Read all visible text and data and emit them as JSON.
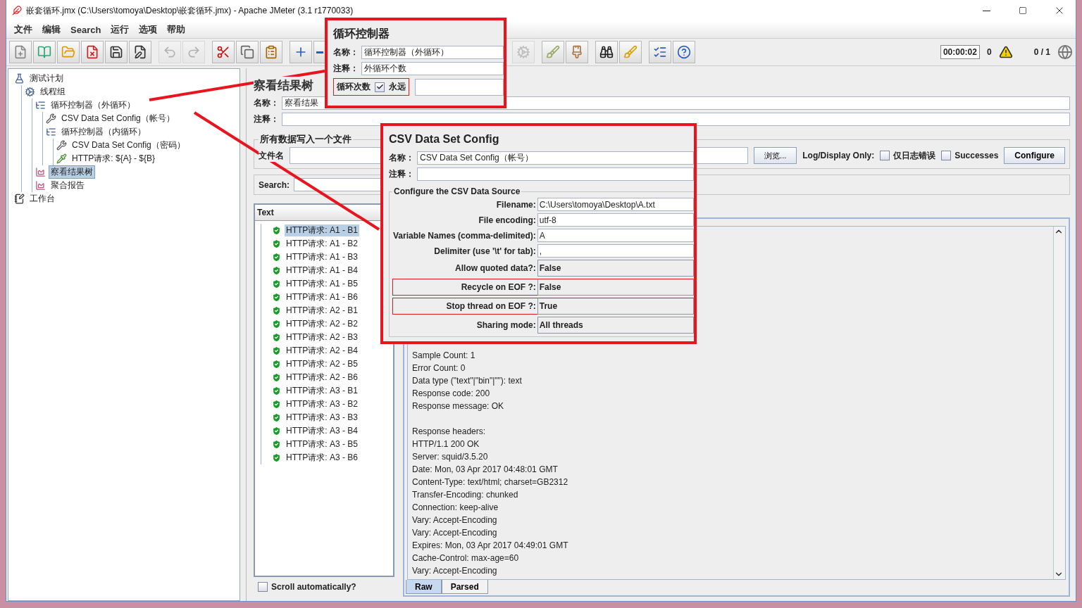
{
  "window": {
    "title": "嵌套循环.jmx (C:\\Users\\tomoya\\Desktop\\嵌套循环.jmx) - Apache JMeter (3.1 r1770033)"
  },
  "menu": [
    "文件",
    "编辑",
    "Search",
    "运行",
    "选项",
    "帮助"
  ],
  "toolbar": {
    "groups": [
      [
        {
          "kind": "new",
          "disabled": false
        },
        {
          "kind": "templates",
          "disabled": false
        },
        {
          "kind": "open",
          "disabled": false
        },
        {
          "kind": "close",
          "disabled": false
        },
        {
          "kind": "save",
          "disabled": false
        },
        {
          "kind": "saveas",
          "disabled": false
        }
      ],
      [
        {
          "kind": "undo",
          "disabled": true
        },
        {
          "kind": "redo",
          "disabled": true
        }
      ],
      [
        {
          "kind": "cut",
          "disabled": false
        },
        {
          "kind": "copy",
          "disabled": false
        },
        {
          "kind": "paste",
          "disabled": false
        }
      ],
      [
        {
          "kind": "expand",
          "disabled": false
        },
        {
          "kind": "collapse",
          "disabled": false
        }
      ],
      [
        {
          "kind": "remote",
          "disabled": true
        }
      ],
      [
        {
          "kind": "clear",
          "disabled": false
        },
        {
          "kind": "clearall",
          "disabled": false
        }
      ],
      [
        {
          "kind": "search",
          "disabled": false
        },
        {
          "kind": "reset",
          "disabled": false
        }
      ],
      [
        {
          "kind": "functions",
          "disabled": false
        },
        {
          "kind": "help",
          "disabled": false
        }
      ]
    ],
    "timer": "00:00:02",
    "warnings": "0",
    "threads": "0 / 1"
  },
  "tree": [
    {
      "label": "测试计划",
      "kind": "plan",
      "selected": false,
      "children": [
        {
          "label": "线程组",
          "kind": "threads",
          "selected": false,
          "children": [
            {
              "label": "循环控制器（外循环）",
              "kind": "controller",
              "selected": false,
              "children": [
                {
                  "label": "CSV Data Set Config（帐号）",
                  "kind": "config",
                  "selected": false
                },
                {
                  "label": "循环控制器（内循环）",
                  "kind": "controller",
                  "selected": false,
                  "children": [
                    {
                      "label": "CSV Data Set Config（密码）",
                      "kind": "config",
                      "selected": false
                    },
                    {
                      "label": "HTTP请求: ${A} - ${B}",
                      "kind": "sampler",
                      "selected": false
                    }
                  ]
                }
              ]
            },
            {
              "label": "察看结果树",
              "kind": "listener",
              "selected": true
            },
            {
              "label": "聚合报告",
              "kind": "listener",
              "selected": false
            }
          ]
        }
      ]
    },
    {
      "label": "工作台",
      "kind": "workbench",
      "selected": false
    }
  ],
  "panel": {
    "title": "察看结果树",
    "name_label": "名称：",
    "name_value": "察看结果",
    "comment_label": "注释：",
    "file_group": {
      "legend": "所有数据写入一个文件",
      "file_label": "文件名",
      "browse": "浏览...",
      "log_label": "Log/Display Only:",
      "options": [
        {
          "label": "仅日志错误",
          "checked": false
        },
        {
          "label": "Successes",
          "checked": false
        }
      ],
      "configure": "Configure"
    },
    "search_label": "Search:",
    "results": {
      "header": "Text",
      "items": [
        {
          "label": "HTTP请求: A1 - B1",
          "selected": true
        },
        {
          "label": "HTTP请求: A1 - B2",
          "selected": false
        },
        {
          "label": "HTTP请求: A1 - B3",
          "selected": false
        },
        {
          "label": "HTTP请求: A1 - B4",
          "selected": false
        },
        {
          "label": "HTTP请求: A1 - B5",
          "selected": false
        },
        {
          "label": "HTTP请求: A1 - B6",
          "selected": false
        },
        {
          "label": "HTTP请求: A2 - B1",
          "selected": false
        },
        {
          "label": "HTTP请求: A2 - B2",
          "selected": false
        },
        {
          "label": "HTTP请求: A2 - B3",
          "selected": false
        },
        {
          "label": "HTTP请求: A2 - B4",
          "selected": false
        },
        {
          "label": "HTTP请求: A2 - B5",
          "selected": false
        },
        {
          "label": "HTTP请求: A2 - B6",
          "selected": false
        },
        {
          "label": "HTTP请求: A3 - B1",
          "selected": false
        },
        {
          "label": "HTTP请求: A3 - B2",
          "selected": false
        },
        {
          "label": "HTTP请求: A3 - B3",
          "selected": false
        },
        {
          "label": "HTTP请求: A3 - B4",
          "selected": false
        },
        {
          "label": "HTTP请求: A3 - B5",
          "selected": false
        },
        {
          "label": "HTTP请求: A3 - B6",
          "selected": false
        }
      ],
      "scroll": {
        "label": "Scroll automatically?",
        "checked": false
      }
    },
    "response": {
      "lines": [
        {
          "text": "Sample Count: 1",
          "spaced": false
        },
        {
          "text": "Error Count: 0",
          "spaced": false
        },
        {
          "text": "Data type (\"text\"|\"bin\"|\"\"): text",
          "spaced": false
        },
        {
          "text": "Response code: 200",
          "spaced": false
        },
        {
          "text": "Response message: OK",
          "spaced": false
        },
        {
          "text": "Response headers:",
          "spaced": true
        },
        {
          "text": "HTTP/1.1 200 OK",
          "spaced": false
        },
        {
          "text": "Server: squid/3.5.20",
          "spaced": false
        },
        {
          "text": "Date: Mon, 03 Apr 2017 04:48:01 GMT",
          "spaced": false
        },
        {
          "text": "Content-Type: text/html; charset=GB2312",
          "spaced": false
        },
        {
          "text": "Transfer-Encoding: chunked",
          "spaced": false
        },
        {
          "text": "Connection: keep-alive",
          "spaced": false
        },
        {
          "text": "Vary: Accept-Encoding",
          "spaced": false
        },
        {
          "text": "Vary: Accept-Encoding",
          "spaced": false
        },
        {
          "text": "Expires: Mon, 03 Apr 2017 04:49:01 GMT",
          "spaced": false
        },
        {
          "text": "Cache-Control: max-age=60",
          "spaced": false
        },
        {
          "text": "Vary: Accept-Encoding",
          "spaced": false
        }
      ],
      "tabs": [
        {
          "label": "Raw",
          "selected": true
        },
        {
          "label": "Parsed",
          "selected": false
        }
      ]
    }
  },
  "callouts": [
    {
      "kind": "loop",
      "title": "循环控制器",
      "name_label": "名称：",
      "name_value": "循环控制器（外循环）",
      "comment_label": "注释：",
      "comment_value": "外循环个数",
      "loops_label": "循环次数",
      "forever": {
        "label": "永远",
        "checked": true
      },
      "highlighted": true
    },
    {
      "kind": "csv",
      "title": "CSV Data Set Config",
      "name_label": "名称：",
      "name_value": "CSV Data Set Config（帐号）",
      "comment_label": "注释：",
      "legend": "Configure the CSV Data Source",
      "rows": [
        {
          "label": "Filename:",
          "value": "C:\\Users\\tomoya\\Desktop\\A.txt",
          "kind": "input",
          "highlighted": false
        },
        {
          "label": "File encoding:",
          "value": "utf-8",
          "kind": "input",
          "highlighted": false
        },
        {
          "label": "Variable Names (comma-delimited):",
          "value": "A",
          "kind": "input",
          "highlighted": false
        },
        {
          "label": "Delimiter (use '\\t' for tab):",
          "value": ",",
          "kind": "input",
          "highlighted": false
        },
        {
          "label": "Allow quoted data?:",
          "value": "False",
          "kind": "select",
          "highlighted": false
        },
        {
          "label": "Recycle on EOF ?:",
          "value": "False",
          "kind": "select",
          "highlighted": true
        },
        {
          "label": "Stop thread on EOF ?:",
          "value": "True",
          "kind": "select",
          "highlighted": true
        },
        {
          "label": "Sharing mode:",
          "value": "All threads",
          "kind": "select",
          "highlighted": false
        }
      ]
    }
  ]
}
